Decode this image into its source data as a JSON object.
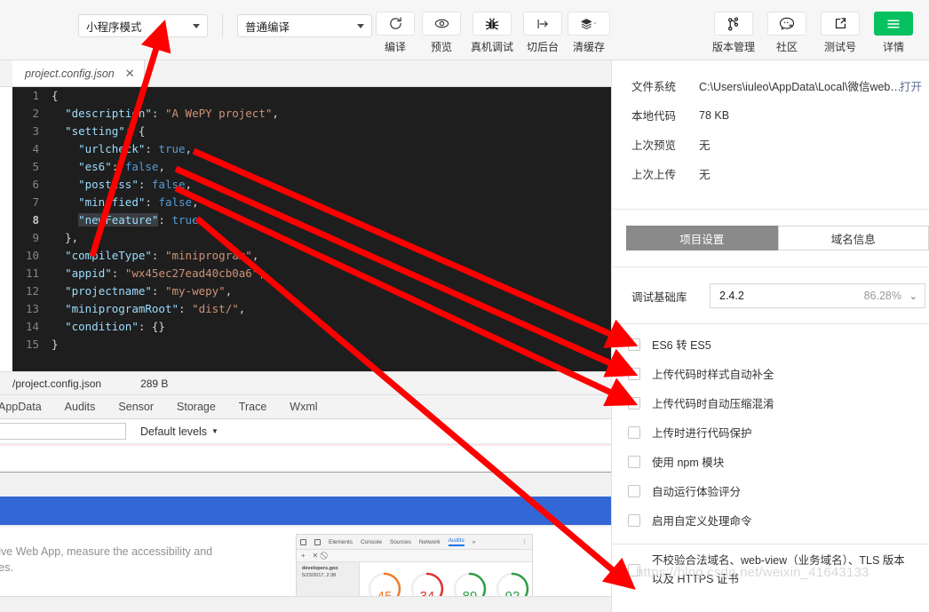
{
  "toolbar": {
    "mode_select": {
      "value": "小程序模式",
      "icon": "chevron-down-icon"
    },
    "compile_select": {
      "value": "普通编译",
      "icon": "chevron-down-icon"
    },
    "actions": [
      {
        "label": "编译",
        "icon": "refresh-icon"
      },
      {
        "label": "预览",
        "icon": "eye-icon"
      },
      {
        "label": "真机调试",
        "icon": "bug-icon"
      },
      {
        "label": "切后台",
        "icon": "switch-background-icon"
      },
      {
        "label": "清缓存",
        "icon": "layers-icon"
      }
    ],
    "right_actions": [
      {
        "label": "版本管理",
        "icon": "version-control-icon"
      },
      {
        "label": "社区",
        "icon": "community-icon"
      },
      {
        "label": "测试号",
        "icon": "external-link-icon"
      },
      {
        "label": "详情",
        "icon": "menu-icon",
        "accent": "#07c160"
      }
    ]
  },
  "editor": {
    "tab_name": "project.config.json",
    "tab_close": "✕",
    "lines": [
      {
        "n": "1",
        "indent": 0,
        "tokens": [
          {
            "t": "{",
            "c": "p"
          }
        ]
      },
      {
        "n": "2",
        "indent": 1,
        "tokens": [
          {
            "t": "\"description\"",
            "c": "k"
          },
          {
            "t": ": ",
            "c": "p"
          },
          {
            "t": "\"A WePY project\"",
            "c": "s"
          },
          {
            "t": ",",
            "c": "p"
          }
        ]
      },
      {
        "n": "3",
        "indent": 1,
        "tokens": [
          {
            "t": "\"setting\"",
            "c": "k"
          },
          {
            "t": ": {",
            "c": "p"
          }
        ]
      },
      {
        "n": "4",
        "indent": 2,
        "tokens": [
          {
            "t": "\"urlcheck\"",
            "c": "k"
          },
          {
            "t": ": ",
            "c": "p"
          },
          {
            "t": "true",
            "c": "b"
          },
          {
            "t": ",",
            "c": "p"
          }
        ]
      },
      {
        "n": "5",
        "indent": 2,
        "tokens": [
          {
            "t": "\"es6\"",
            "c": "k"
          },
          {
            "t": ": ",
            "c": "p"
          },
          {
            "t": "false",
            "c": "b"
          },
          {
            "t": ",",
            "c": "p"
          }
        ]
      },
      {
        "n": "6",
        "indent": 2,
        "tokens": [
          {
            "t": "\"postcss\"",
            "c": "k"
          },
          {
            "t": ": ",
            "c": "p"
          },
          {
            "t": "false",
            "c": "b"
          },
          {
            "t": ",",
            "c": "p"
          }
        ]
      },
      {
        "n": "7",
        "indent": 2,
        "tokens": [
          {
            "t": "\"minified\"",
            "c": "k"
          },
          {
            "t": ": ",
            "c": "p"
          },
          {
            "t": "false",
            "c": "b"
          },
          {
            "t": ",",
            "c": "p"
          }
        ]
      },
      {
        "n": "8",
        "indent": 2,
        "current": true,
        "tokens": [
          {
            "t": "\"newFeature\"",
            "c": "k sel"
          },
          {
            "t": ": ",
            "c": "p"
          },
          {
            "t": "true",
            "c": "b"
          }
        ]
      },
      {
        "n": "9",
        "indent": 1,
        "tokens": [
          {
            "t": "},",
            "c": "p"
          }
        ]
      },
      {
        "n": "10",
        "indent": 1,
        "tokens": [
          {
            "t": "\"compileType\"",
            "c": "k"
          },
          {
            "t": ": ",
            "c": "p"
          },
          {
            "t": "\"miniprogram\"",
            "c": "s"
          },
          {
            "t": ",",
            "c": "p"
          }
        ]
      },
      {
        "n": "11",
        "indent": 1,
        "tokens": [
          {
            "t": "\"appid\"",
            "c": "k"
          },
          {
            "t": ": ",
            "c": "p"
          },
          {
            "t": "\"wx45ec27ead40cb0a6\"",
            "c": "s"
          },
          {
            "t": ",",
            "c": "p"
          }
        ]
      },
      {
        "n": "12",
        "indent": 1,
        "tokens": [
          {
            "t": "\"projectname\"",
            "c": "k"
          },
          {
            "t": ": ",
            "c": "p"
          },
          {
            "t": "\"my-wepy\"",
            "c": "s"
          },
          {
            "t": ",",
            "c": "p"
          }
        ]
      },
      {
        "n": "13",
        "indent": 1,
        "tokens": [
          {
            "t": "\"miniprogramRoot\"",
            "c": "k"
          },
          {
            "t": ": ",
            "c": "p"
          },
          {
            "t": "\"dist/\"",
            "c": "s"
          },
          {
            "t": ",",
            "c": "p"
          }
        ]
      },
      {
        "n": "14",
        "indent": 1,
        "tokens": [
          {
            "t": "\"condition\"",
            "c": "k"
          },
          {
            "t": ": {}",
            "c": "p"
          }
        ]
      },
      {
        "n": "15",
        "indent": 0,
        "tokens": [
          {
            "t": "}",
            "c": "p"
          }
        ]
      }
    ]
  },
  "statusbar": {
    "path": "/project.config.json",
    "size": "289 B"
  },
  "panel": {
    "tabs": [
      "AppData",
      "Audits",
      "Sensor",
      "Storage",
      "Trace",
      "Wxml"
    ],
    "filter_placeholder": "",
    "filter_value": "",
    "levels_label": "Default levels",
    "levels_caret": "▼",
    "audits_description": "sive Web App, measure the accessibility and\nces.",
    "devtools_thumb": {
      "tabs": [
        "Elements",
        "Console",
        "Sources",
        "Network",
        "Audits"
      ],
      "overflow": "»",
      "menu": "⋮",
      "sub_icons": [
        "+",
        "✕",
        "⃠"
      ],
      "entry_title": "developers.goo",
      "entry_time": "5/23/2017, 2:38",
      "gauges": [
        {
          "value": "45",
          "color": "#ef7b28"
        },
        {
          "value": "34",
          "color": "#e03030"
        },
        {
          "value": "89",
          "color": "#2f9e44"
        },
        {
          "value": "92",
          "color": "#2f9e44"
        }
      ]
    }
  },
  "detail": {
    "info": [
      {
        "label": "文件系统",
        "value": "C:\\Users\\iuleo\\AppData\\Local\\微信web…",
        "action": "打开"
      },
      {
        "label": "本地代码",
        "value": "78 KB",
        "action": ""
      },
      {
        "label": "上次预览",
        "value": "无",
        "action": ""
      },
      {
        "label": "上次上传",
        "value": "无",
        "action": ""
      }
    ],
    "tabs": [
      {
        "label": "项目设置",
        "active": true
      },
      {
        "label": "域名信息",
        "active": false
      }
    ],
    "base_library": {
      "label": "调试基础库",
      "value": "2.4.2",
      "percent": "86.28%",
      "caret": "⌄"
    },
    "checkboxes": [
      {
        "label": "ES6 转 ES5",
        "checked": false
      },
      {
        "label": "上传代码时样式自动补全",
        "checked": false
      },
      {
        "label": "上传代码时自动压缩混淆",
        "checked": false
      },
      {
        "label": "上传时进行代码保护",
        "checked": false
      },
      {
        "label": "使用 npm 模块",
        "checked": false
      },
      {
        "label": "自动运行体验评分",
        "checked": false
      },
      {
        "label": "启用自定义处理命令",
        "checked": false
      }
    ],
    "checkbox_last": {
      "label": "不校验合法域名、web-view（业务域名）、TLS 版本以及 HTTPS 证书",
      "checked": false
    }
  },
  "annotations": {
    "color": "#fe0000",
    "watermark": "https://blog.csdn.net/weixin_41643133"
  }
}
